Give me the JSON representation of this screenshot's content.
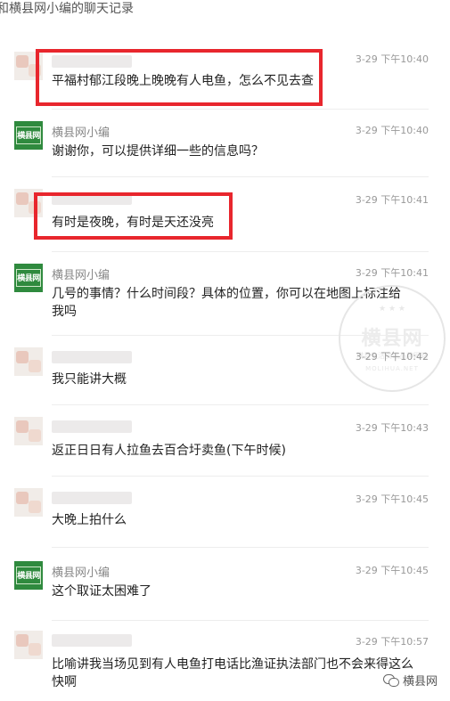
{
  "header": {
    "title": "和横县网小编的聊天记录"
  },
  "messages": [
    {
      "sender": "",
      "time": "3-29 下午10:40",
      "text": "平福村郁江段晚上晚晚有人电鱼，怎么不见去查"
    },
    {
      "sender": "横县网小编",
      "time": "3-29 下午10:40",
      "text": "谢谢你，可以提供详细一些的信息吗？"
    },
    {
      "sender": "",
      "time": "3-29 下午10:41",
      "text": "有时是夜晚，有时是天还没亮"
    },
    {
      "sender": "横县网小编",
      "time": "3-29 下午10:41",
      "text": "几号的事情？什么时间段？具体的位置，你可以在地图上标注给我吗"
    },
    {
      "sender": "",
      "time": "3-29 下午10:42",
      "text": "我只能讲大概"
    },
    {
      "sender": "",
      "time": "3-29 下午10:43",
      "text": "返正日日有人拉鱼去百合圩卖鱼(下午时候)"
    },
    {
      "sender": "",
      "time": "3-29 下午10:45",
      "text": "大晚上拍什么"
    },
    {
      "sender": "横县网小编",
      "time": "3-29 下午10:45",
      "text": "这个取证太困难了"
    },
    {
      "sender": "",
      "time": "3-29 下午10:57",
      "text": "比喻讲我当场见到有人电鱼打电话比渔证执法部门也不会来得这么快啊"
    }
  ],
  "avatar_logo": "横县网",
  "watermark": {
    "main": "横县网",
    "sub": "横县生活资讯品牌网站",
    "url": "MOLIHUA.NET",
    "stars": "★ ★ ★"
  },
  "footer": {
    "brand": "横县网",
    "icon": "wechat-icon"
  },
  "colors": {
    "highlight": "#e8262d",
    "logo_green": "#2f8a3e"
  }
}
